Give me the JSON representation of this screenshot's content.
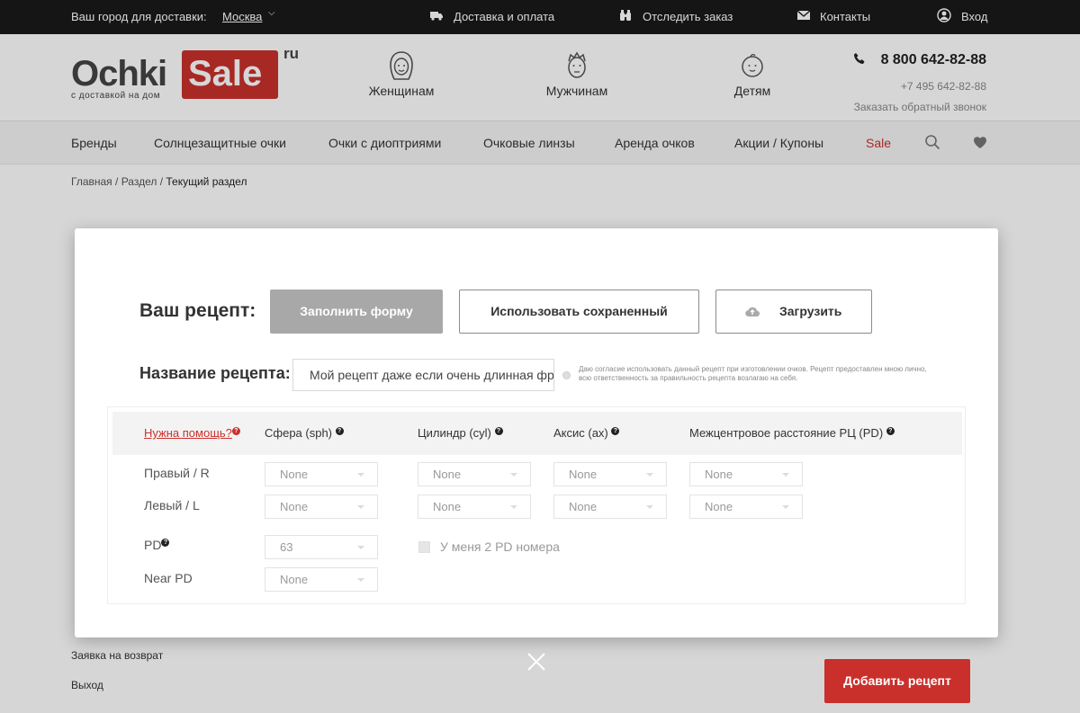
{
  "topbar": {
    "city_label": "Ваш город для доставки:",
    "city": "Москва",
    "delivery": "Доставка и оплата",
    "track": "Отследить заказ",
    "contacts": "Контакты",
    "login": "Вход"
  },
  "header": {
    "logo_ochki": "Ochki",
    "logo_sale": "Sale",
    "logo_ru": "ru",
    "logo_tagline": "с доставкой на дом",
    "categories": [
      "Женщинам",
      "Мужчинам",
      "Детям"
    ],
    "phone_main": "8 800 642-82-88",
    "phone_alt": "+7 495 642-82-88",
    "callback": "Заказать обратный звонок"
  },
  "nav": {
    "items": [
      "Бренды",
      "Солнцезащитные очки",
      "Очки с диоптриями",
      "Очковые линзы",
      "Аренда очков",
      "Акции / Купоны",
      "Sale"
    ]
  },
  "breadcrumb": {
    "home": "Главная",
    "section": "Раздел",
    "current": "Текущий раздел"
  },
  "side_menu": {
    "return": "Заявка на возврат",
    "logout": "Выход"
  },
  "modal": {
    "title": "Ваш рецепт:",
    "btn_fill": "Заполнить форму",
    "btn_saved": "Использовать сохраненный",
    "btn_upload": "Загрузить",
    "name_label": "Название рецепта:",
    "name_value": "Мой рецепт даже если очень длинная фраза",
    "consent": "Даю согласие использовать данный рецепт при изготовлении очков. Рецепт предоставлен мною лично, всю ответственность за правильность рецепта возлагаю на себя.",
    "help": "Нужна помощь?",
    "col_sph": "Сфера (sph)",
    "col_cyl": "Цилиндр (cyl)",
    "col_ax": "Аксис (ax)",
    "col_pd": "Межцентровое расстояние РЦ (PD)",
    "row_right": "Правый / R",
    "row_left": "Левый / L",
    "row_pd": "PD",
    "row_near_pd": "Near PD",
    "sel_none": "None",
    "pd_value": "63",
    "two_pd": "У меня 2 PD номера",
    "q": "?"
  },
  "add_button": "Добавить рецепт",
  "colors": {
    "accent": "#c9302c",
    "topbar": "#1a1a1a"
  }
}
